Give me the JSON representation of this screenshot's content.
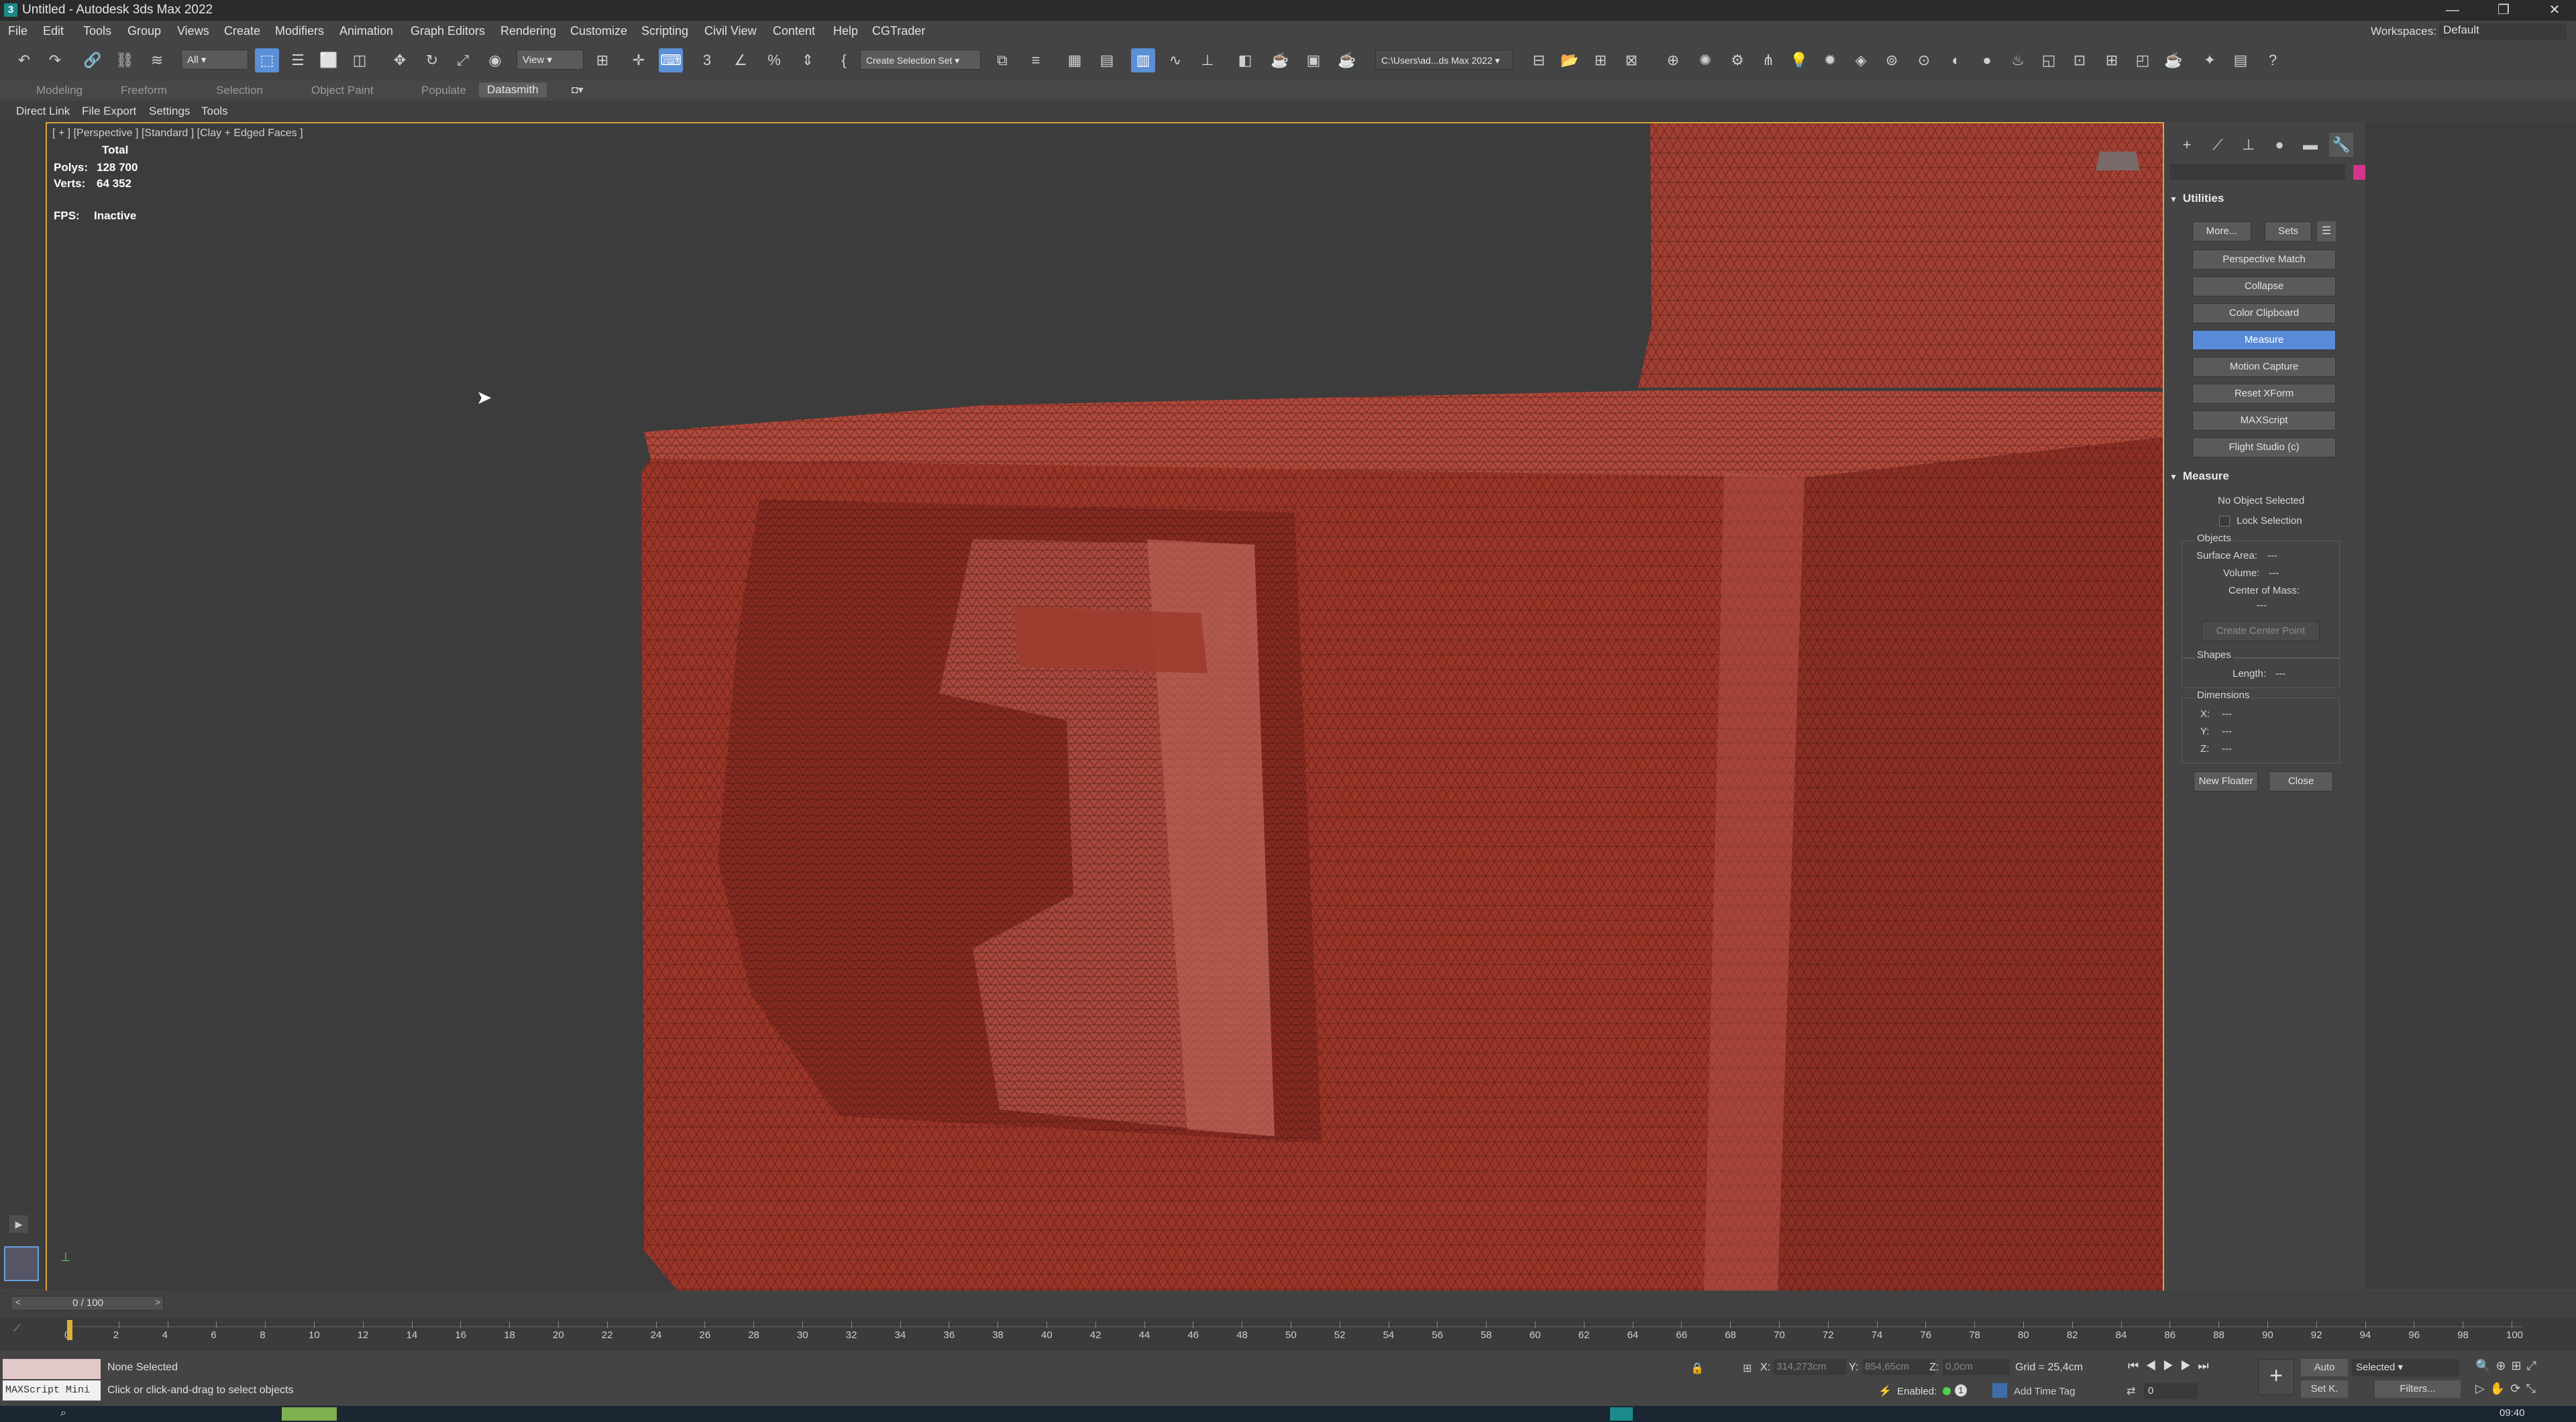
{
  "window": {
    "title": "Untitled - Autodesk 3ds Max 2022",
    "app_icon": "3ds-max-icon",
    "controls": [
      "—",
      "❐",
      "✕"
    ]
  },
  "menubar": {
    "items": [
      "File",
      "Edit",
      "Tools",
      "Group",
      "Views",
      "Create",
      "Modifiers",
      "Animation",
      "Graph Editors",
      "Rendering",
      "Customize",
      "Scripting",
      "Civil View",
      "Content",
      "Help",
      "CGTrader"
    ],
    "workspaces_label": "Workspaces:",
    "workspaces_value": "Default"
  },
  "toolbar": {
    "selection_filter": "All",
    "ref_coord": "View",
    "named_selection": "Create Selection Set",
    "project_path": "C:\\Users\\ad...ds Max 2022"
  },
  "ribbon": {
    "tabs": [
      "Modeling",
      "Freeform",
      "Selection",
      "Object Paint",
      "Populate",
      "Datasmith"
    ],
    "active_tab": "Datasmith",
    "subtabs": [
      "Direct Link",
      "File Export",
      "Settings",
      "Tools"
    ]
  },
  "viewport": {
    "label": "[ + ] [Perspective ] [Standard ] [Clay + Edged Faces ]",
    "stats_total": "Total",
    "polys_label": "Polys:",
    "polys_value": "128 700",
    "verts_label": "Verts:",
    "verts_value": "64 352",
    "fps_label": "FPS:",
    "fps_value": "Inactive",
    "mesh_color": "#9e3a2e"
  },
  "command_panel": {
    "utilities_title": "Utilities",
    "more": "More...",
    "sets": "Sets",
    "buttons": [
      "Perspective Match",
      "Collapse",
      "Color Clipboard",
      "Measure",
      "Motion Capture",
      "Reset XForm",
      "MAXScript",
      "Flight Studio (c)"
    ],
    "selected_button": "Measure",
    "measure_title": "Measure",
    "no_object": "No Object Selected",
    "lock_selection": "Lock Selection",
    "objects_group": "Objects",
    "surface_area": "Surface Area:",
    "volume": "Volume:",
    "center_of_mass": "Center of Mass:",
    "dashes": "---",
    "create_center_point": "Create Center Point",
    "shapes_group": "Shapes",
    "length": "Length:",
    "dimensions_group": "Dimensions",
    "x": "X:",
    "y": "Y:",
    "z": "Z:",
    "new_floater": "New Floater",
    "close": "Close",
    "swatch_color": "#d4358a"
  },
  "timeline": {
    "frame_display": "0 / 100",
    "ticks": [
      "0",
      "2",
      "4",
      "6",
      "8",
      "10",
      "12",
      "14",
      "16",
      "18",
      "20",
      "22",
      "24",
      "26",
      "28",
      "30",
      "32",
      "34",
      "36",
      "38",
      "40",
      "42",
      "44",
      "46",
      "48",
      "50",
      "52",
      "54",
      "56",
      "58",
      "60",
      "62",
      "64",
      "66",
      "68",
      "70",
      "72",
      "74",
      "76",
      "78",
      "80",
      "82",
      "84",
      "86",
      "88",
      "90",
      "92",
      "94",
      "96",
      "98",
      "100"
    ]
  },
  "status": {
    "maxscript": "MAXScript Mini",
    "selection": "None Selected",
    "prompt": "Click or click-and-drag to select objects",
    "x_label": "X:",
    "x_value": "314,273cm",
    "y_label": "Y:",
    "y_value": "854,65cm",
    "z_label": "Z:",
    "z_value": "0,0cm",
    "grid": "Grid = 25,4cm",
    "enabled": "Enabled:",
    "add_time_tag": "Add Time Tag",
    "auto": "Auto",
    "set_key": "Set K.",
    "key_filter": "Selected",
    "filters": "Filters...",
    "frame_spinner": "0",
    "clock": "09:40"
  }
}
